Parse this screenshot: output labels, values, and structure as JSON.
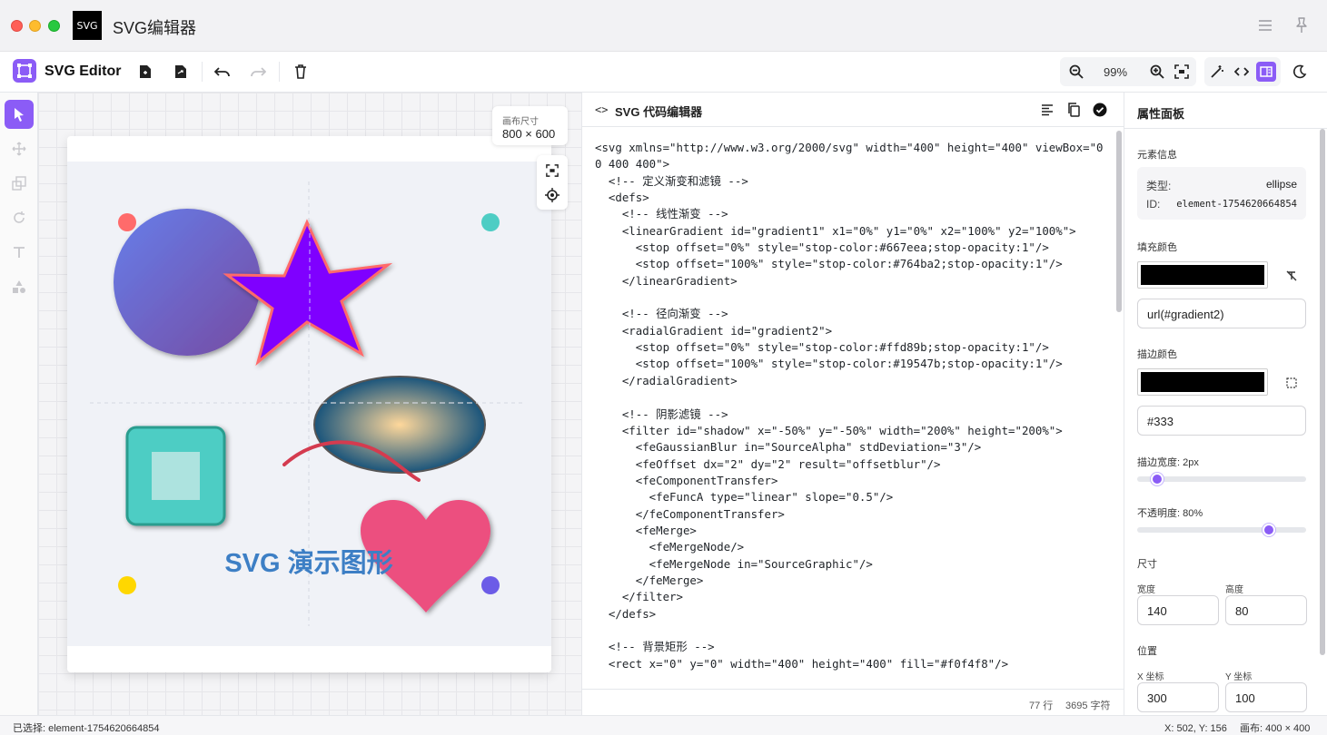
{
  "window": {
    "app_icon_text": "SVG",
    "title": "SVG编辑器"
  },
  "toolbar": {
    "brand": "SVG Editor",
    "zoom": "99%"
  },
  "canvas": {
    "size_label": "画布尺寸",
    "size_value": "800 × 600",
    "demo_text": "SVG 演示图形",
    "colors": {
      "circle_gradient": [
        "#667eea",
        "#764ba2"
      ],
      "star_fill": "#7f00ff",
      "star_stroke": "#ff6b6b",
      "radial_gradient": [
        "#ffd89b",
        "#19547b"
      ],
      "square": "#4ecdc4",
      "heart": "#ec4f7f",
      "text": "#3d7fc5",
      "dots": [
        "#ff6b6b",
        "#4ecdc4",
        "#ffd700",
        "#6c5ce7"
      ]
    }
  },
  "code_editor": {
    "title_icon": "<>",
    "title": "SVG 代码编辑器",
    "lines": [
      "<svg xmlns=\"http://www.w3.org/2000/svg\" width=\"400\" height=\"400\" viewBox=\"0",
      "0 400 400\">",
      "  <!-- 定义渐变和滤镜 -->",
      "  <defs>",
      "    <!-- 线性渐变 -->",
      "    <linearGradient id=\"gradient1\" x1=\"0%\" y1=\"0%\" x2=\"100%\" y2=\"100%\">",
      "      <stop offset=\"0%\" style=\"stop-color:#667eea;stop-opacity:1\"/>",
      "      <stop offset=\"100%\" style=\"stop-color:#764ba2;stop-opacity:1\"/>",
      "    </linearGradient>",
      "",
      "    <!-- 径向渐变 -->",
      "    <radialGradient id=\"gradient2\">",
      "      <stop offset=\"0%\" style=\"stop-color:#ffd89b;stop-opacity:1\"/>",
      "      <stop offset=\"100%\" style=\"stop-color:#19547b;stop-opacity:1\"/>",
      "    </radialGradient>",
      "",
      "    <!-- 阴影滤镜 -->",
      "    <filter id=\"shadow\" x=\"-50%\" y=\"-50%\" width=\"200%\" height=\"200%\">",
      "      <feGaussianBlur in=\"SourceAlpha\" stdDeviation=\"3\"/>",
      "      <feOffset dx=\"2\" dy=\"2\" result=\"offsetblur\"/>",
      "      <feComponentTransfer>",
      "        <feFuncA type=\"linear\" slope=\"0.5\"/>",
      "      </feComponentTransfer>",
      "      <feMerge>",
      "        <feMergeNode/>",
      "        <feMergeNode in=\"SourceGraphic\"/>",
      "      </feMerge>",
      "    </filter>",
      "  </defs>",
      "",
      "  <!-- 背景矩形 -->",
      "  <rect x=\"0\" y=\"0\" width=\"400\" height=\"400\" fill=\"#f0f4f8\"/>"
    ],
    "line_count": "77 行",
    "char_count": "3695 字符"
  },
  "properties": {
    "title": "属性面板",
    "element_info": {
      "label": "元素信息",
      "type_key": "类型:",
      "type_value": "ellipse",
      "id_key": "ID:",
      "id_value": "element-1754620664854"
    },
    "fill": {
      "label": "填充颜色",
      "value": "url(#gradient2)"
    },
    "stroke": {
      "label": "描边颜色",
      "value": "#333"
    },
    "stroke_width": {
      "label": "描边宽度: 2px",
      "fraction": 0.09
    },
    "opacity": {
      "label": "不透明度: 80%",
      "fraction": 0.8
    },
    "size": {
      "label": "尺寸",
      "width_label": "宽度",
      "width_value": "140",
      "height_label": "高度",
      "height_value": "80"
    },
    "position": {
      "label": "位置",
      "x_label": "X 坐标",
      "x_value": "300",
      "y_label": "Y 坐标",
      "y_value": "100"
    }
  },
  "status": {
    "selected": "已选择: element-1754620664854",
    "cursor": "X: 502, Y: 156",
    "canvas": "画布: 400 × 400"
  },
  "accent_color": "#8b5cf6"
}
